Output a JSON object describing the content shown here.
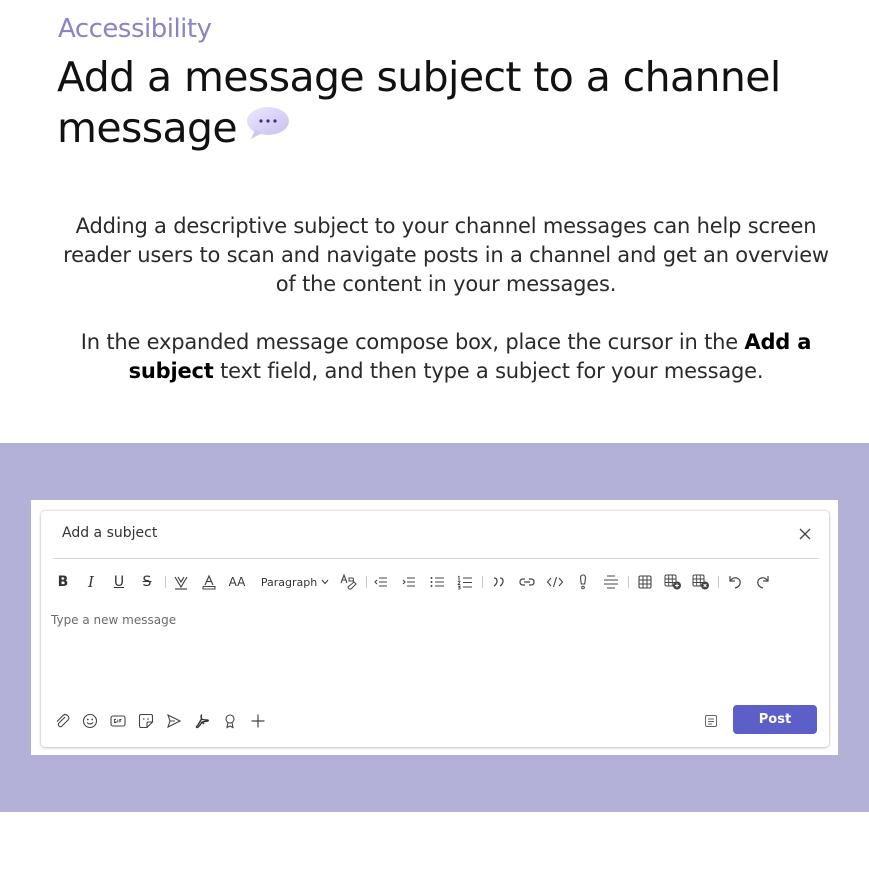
{
  "header": {
    "category": "Accessibility",
    "title": "Add a message subject to a channel message"
  },
  "description": {
    "paragraph1": "Adding a descriptive subject to your channel messages can help screen reader users to scan and navigate posts in a channel and get an overview of the content in your messages.",
    "paragraph2_prefix": "In the expanded message compose box, place the cursor in the ",
    "paragraph2_bold": "Add a subject",
    "paragraph2_suffix": " text field, and then type a subject for your message."
  },
  "compose": {
    "subject_placeholder": "Add a subject",
    "message_placeholder": "Type a new message",
    "toolbar": {
      "bold": "B",
      "italic": "I",
      "underline": "U",
      "strikethrough": "S",
      "font_size": "AA",
      "paragraph": "Paragraph"
    },
    "post_label": "Post"
  },
  "colors": {
    "accent": "#5b5fc7",
    "band": "#b3b1d8",
    "category": "#8b84c4"
  }
}
